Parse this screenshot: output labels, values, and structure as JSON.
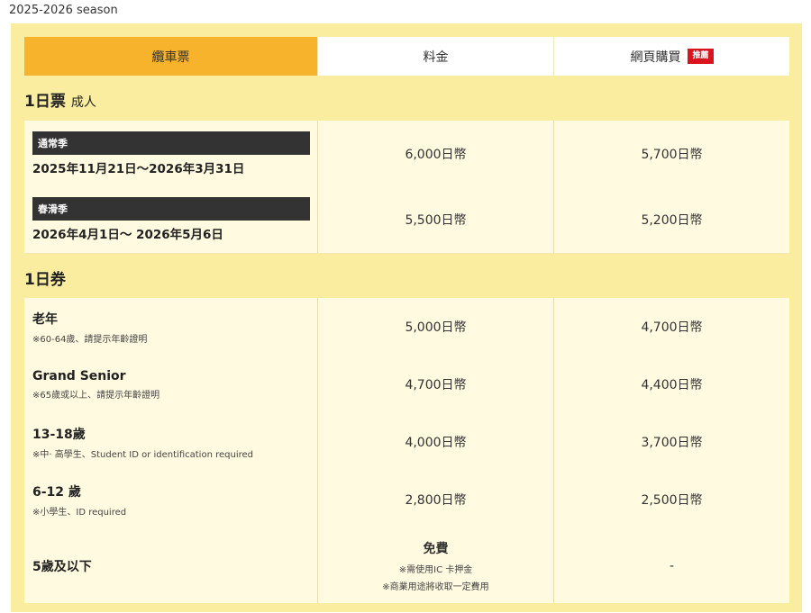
{
  "season_label": "2025-2026 season",
  "header": {
    "col1": "纜車票",
    "col2": "料金",
    "col3": "網頁購買",
    "badge": "推薦"
  },
  "section1": {
    "title": "1日票",
    "sub": "成人"
  },
  "adult_rows": [
    {
      "tag": "通常季",
      "dates": "2025年11月21日〜2026年3月31日",
      "price": "6,000日幣",
      "web_price": "5,700日幣"
    },
    {
      "tag": "春滑季",
      "dates": "2026年4月1日〜 2026年5月6日",
      "price": "5,500日幣",
      "web_price": "5,200日幣"
    }
  ],
  "section2": {
    "title": "1日券"
  },
  "rows": [
    {
      "label": "老年",
      "note": "※60-64歲、請提示年齡證明",
      "price": "5,000日幣",
      "web_price": "4,700日幣"
    },
    {
      "label": "Grand Senior",
      "note": "※65歲或以上、請提示年齡證明",
      "price": "4,700日幣",
      "web_price": "4,400日幣"
    },
    {
      "label": "13-18歲",
      "note": "※中· 高學生、Student ID or identification required",
      "price": "4,000日幣",
      "web_price": "3,700日幣"
    },
    {
      "label": "6-12 歲",
      "note": "※小學生、ID required",
      "price": "2,800日幣",
      "web_price": "2,500日幣"
    }
  ],
  "last_row": {
    "label": "5歲及以下",
    "price": "免費",
    "note1": "※需使用IC 卡押金",
    "note2": "※商業用途將收取一定費用",
    "web_price": "-"
  },
  "colors": {
    "panel": "#faeda0",
    "header_accent": "#f7b32c",
    "badge": "#d8141e",
    "tag": "#333333"
  }
}
